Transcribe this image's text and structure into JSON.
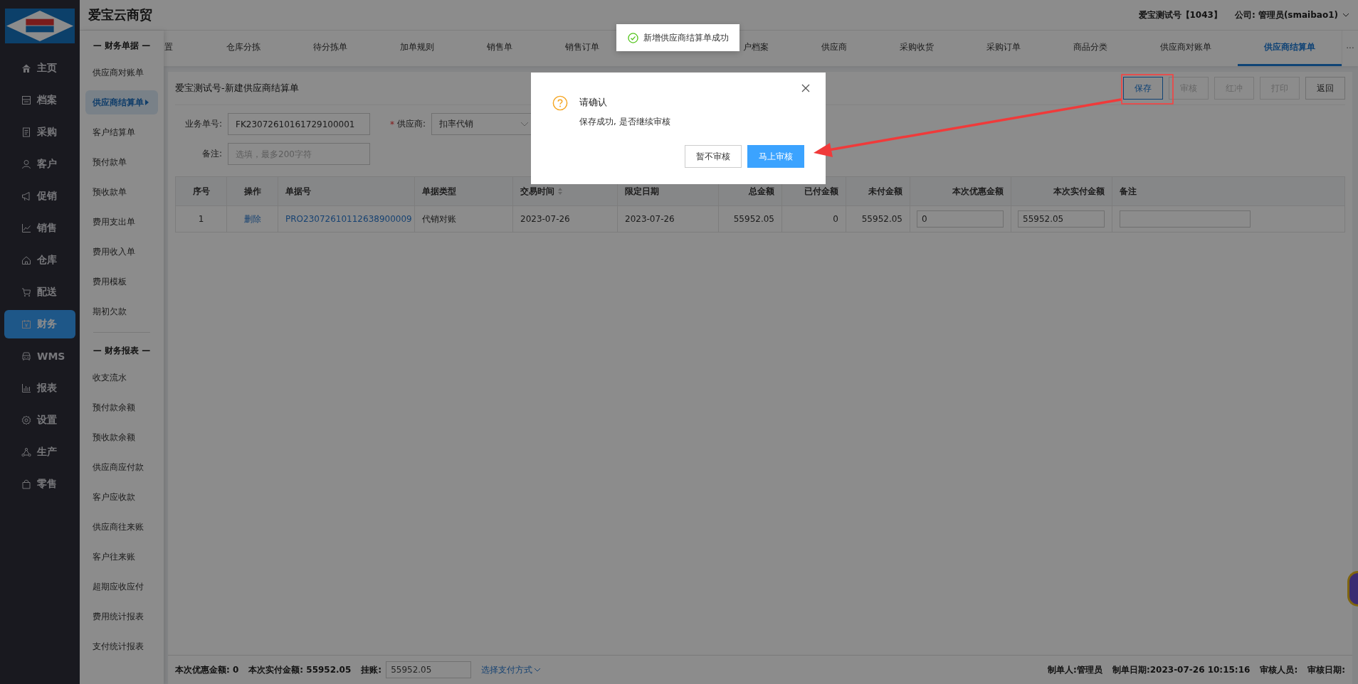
{
  "brand": "爱宝云商贸",
  "account": {
    "store": "爱宝测试号【1043】",
    "company": "公司: 管理员(smaibao1)"
  },
  "nav": [
    {
      "label": "主页",
      "selected": false
    },
    {
      "label": "档案",
      "selected": false
    },
    {
      "label": "采购",
      "selected": false
    },
    {
      "label": "客户",
      "selected": false
    },
    {
      "label": "促销",
      "selected": false
    },
    {
      "label": "销售",
      "selected": false
    },
    {
      "label": "仓库",
      "selected": false
    },
    {
      "label": "配送",
      "selected": false
    },
    {
      "label": "财务",
      "selected": true
    },
    {
      "label": "WMS",
      "selected": false
    },
    {
      "label": "报表",
      "selected": false
    },
    {
      "label": "设置",
      "selected": false
    },
    {
      "label": "生产",
      "selected": false
    },
    {
      "label": "零售",
      "selected": false
    }
  ],
  "submenu": [
    {
      "title": "— 财务单据 —",
      "items": [
        {
          "label": "供应商对账单",
          "selected": false
        },
        {
          "label": "供应商结算单",
          "selected": true
        },
        {
          "label": "客户结算单",
          "selected": false
        },
        {
          "label": "预付款单",
          "selected": false
        },
        {
          "label": "预收款单",
          "selected": false
        },
        {
          "label": "费用支出单",
          "selected": false
        },
        {
          "label": "费用收入单",
          "selected": false
        },
        {
          "label": "费用模板",
          "selected": false
        },
        {
          "label": "期初欠款",
          "selected": false
        }
      ]
    },
    {
      "title": "— 财务报表 —",
      "items": [
        {
          "label": "收支流水",
          "selected": false
        },
        {
          "label": "预付款余额",
          "selected": false
        },
        {
          "label": "预收款余额",
          "selected": false
        },
        {
          "label": "供应商应付款",
          "selected": false
        },
        {
          "label": "客户应收款",
          "selected": false
        },
        {
          "label": "供应商往来账",
          "selected": false
        },
        {
          "label": "客户往来账",
          "selected": false
        },
        {
          "label": "超期应收应付",
          "selected": false
        },
        {
          "label": "费用统计报表",
          "selected": false
        },
        {
          "label": "支付统计报表",
          "selected": false
        }
      ]
    }
  ],
  "tabs": [
    {
      "label": "置",
      "selected": false
    },
    {
      "label": "仓库分拣",
      "selected": false
    },
    {
      "label": "待分拣单",
      "selected": false
    },
    {
      "label": "加单规则",
      "selected": false
    },
    {
      "label": "销售单",
      "selected": false
    },
    {
      "label": "销售订单",
      "selected": false
    },
    {
      "label": "户档案",
      "selected": false
    },
    {
      "label": "供应商",
      "selected": false
    },
    {
      "label": "采购收货",
      "selected": false
    },
    {
      "label": "采购订单",
      "selected": false
    },
    {
      "label": "商品分类",
      "selected": false
    },
    {
      "label": "供应商对账单",
      "selected": false
    },
    {
      "label": "供应商结算单",
      "selected": true
    }
  ],
  "tabs_more": "···",
  "page_title": "爱宝测试号-新建供应商结算单",
  "actions": [
    {
      "label": "保存",
      "disabled": false,
      "focused": true
    },
    {
      "label": "审核",
      "disabled": true,
      "focused": false
    },
    {
      "label": "红冲",
      "disabled": true,
      "focused": false
    },
    {
      "label": "打印",
      "disabled": true,
      "focused": false
    },
    {
      "label": "返回",
      "disabled": false,
      "focused": false
    }
  ],
  "form": {
    "order_no": {
      "label": "业务单号:",
      "value": "FK23072610161729100001"
    },
    "supplier": {
      "label": "供应商:",
      "required_mark": "*",
      "value": "扣率代销"
    },
    "remark": {
      "label": "备注:",
      "placeholder": "选填，最多200字符"
    }
  },
  "table": {
    "columns": [
      {
        "label": "序号"
      },
      {
        "label": "操作"
      },
      {
        "label": "单据号"
      },
      {
        "label": "单据类型"
      },
      {
        "label": "交易时间",
        "sortable": true
      },
      {
        "label": "限定日期"
      },
      {
        "label": "总金额"
      },
      {
        "label": "已付金额"
      },
      {
        "label": "未付金额"
      },
      {
        "label": "本次优惠金额"
      },
      {
        "label": "本次实付金额"
      },
      {
        "label": "备注"
      }
    ],
    "rows": [
      {
        "cells": [
          {
            "kind": "text",
            "text": "1"
          },
          {
            "kind": "link",
            "text": "删除"
          },
          {
            "kind": "link",
            "text": "PRO23072610112638900009"
          },
          {
            "kind": "text",
            "text": "代销对账"
          },
          {
            "kind": "text",
            "text": "2023-07-26"
          },
          {
            "kind": "text",
            "text": "2023-07-26"
          },
          {
            "kind": "text",
            "text": "55952.05"
          },
          {
            "kind": "text",
            "text": "0"
          },
          {
            "kind": "text",
            "text": "55952.05"
          },
          {
            "kind": "input",
            "text": "0"
          },
          {
            "kind": "input",
            "text": "55952.05"
          },
          {
            "kind": "input",
            "text": ""
          }
        ]
      }
    ]
  },
  "footer": {
    "left": [
      {
        "label": "本次优惠金额:",
        "value": "0"
      },
      {
        "label": "本次实付金额:",
        "value": "55952.05"
      }
    ],
    "credit": {
      "label": "挂账:",
      "value": "55952.05"
    },
    "payment_link": "选择支付方式",
    "right": [
      {
        "label": "制单人:",
        "value": "管理员"
      },
      {
        "label": "制单日期:",
        "value": "2023-07-26 10:15:16"
      },
      {
        "label": "审核人员:"
      },
      {
        "label": "审核日期:"
      }
    ]
  },
  "toast": {
    "message": "新增供应商结算单成功"
  },
  "dialog": {
    "title": "请确认",
    "message": "保存成功, 是否继续审核",
    "buttons": [
      {
        "label": "暂不审核",
        "primary": false
      },
      {
        "label": "马上审核",
        "primary": true
      }
    ]
  }
}
